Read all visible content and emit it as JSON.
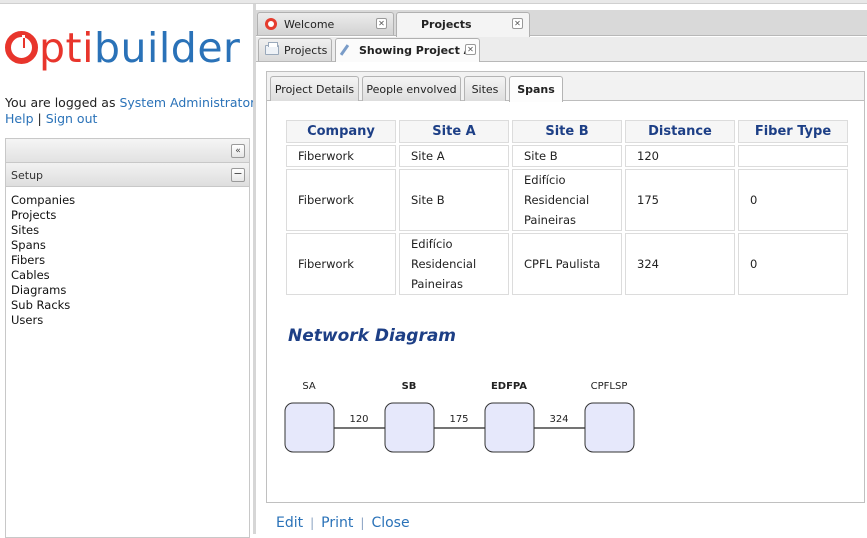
{
  "app": {
    "logo_prefix": "o",
    "logo_red": "pti",
    "logo_blue": "builder"
  },
  "session": {
    "logged_as_text": "You are logged as ",
    "user_name": "System Administrator",
    "help_label": "Help",
    "separator": "|",
    "signout_label": "Sign out"
  },
  "sidebar": {
    "collapse_icon": "double-chevron-left-icon",
    "section_title": "Setup",
    "minimize_icon": "minus-icon",
    "items": [
      {
        "label": "Companies"
      },
      {
        "label": "Projects"
      },
      {
        "label": "Sites"
      },
      {
        "label": "Spans"
      },
      {
        "label": "Fibers"
      },
      {
        "label": "Cables"
      },
      {
        "label": "Diagrams"
      },
      {
        "label": "Sub Racks"
      },
      {
        "label": "Users"
      }
    ]
  },
  "main_tabs": [
    {
      "label": "Welcome",
      "active": false,
      "icon": "optibuilder-icon"
    },
    {
      "label": "Projects",
      "active": true
    }
  ],
  "sub_tabs": [
    {
      "label": "Projects",
      "active": false,
      "icon": "document-icon"
    },
    {
      "label": "Showing Project A",
      "active": true,
      "icon": "pencil-icon"
    }
  ],
  "detail_tabs": [
    {
      "label": "Project Details",
      "active": false
    },
    {
      "label": "People envolved",
      "active": false
    },
    {
      "label": "Sites",
      "active": false
    },
    {
      "label": "Spans",
      "active": true
    }
  ],
  "spans_table": {
    "headers": [
      "Company",
      "Site A",
      "Site B",
      "Distance",
      "Fiber Type"
    ],
    "rows": [
      {
        "company": "Fiberwork",
        "site_a": [
          "Site A"
        ],
        "site_b": [
          "Site B"
        ],
        "distance": "120",
        "fiber_type": ""
      },
      {
        "company": "Fiberwork",
        "site_a": [
          "Site B"
        ],
        "site_b": [
          "Edifício",
          "Residencial",
          "Paineiras"
        ],
        "distance": "175",
        "fiber_type": "0"
      },
      {
        "company": "Fiberwork",
        "site_a": [
          "Edifício",
          "Residencial",
          "Paineiras"
        ],
        "site_b": [
          "CPFL Paulista"
        ],
        "distance": "324",
        "fiber_type": "0"
      }
    ]
  },
  "diagram": {
    "title": "Network Diagram",
    "nodes": [
      {
        "label": "SA",
        "bold": false
      },
      {
        "label": "SB",
        "bold": true
      },
      {
        "label": "EDFPA",
        "bold": true
      },
      {
        "label": "CPFLSP",
        "bold": false
      }
    ],
    "links": [
      {
        "label": "120"
      },
      {
        "label": "175"
      },
      {
        "label": "324"
      }
    ],
    "colors": {
      "node_fill": "#e6e8fb",
      "node_stroke": "#333333",
      "link": "#222222"
    }
  },
  "actions": {
    "edit_label": "Edit",
    "print_label": "Print",
    "close_label": "Close",
    "separator": "|"
  },
  "colors": {
    "brand_red": "#e8352c",
    "brand_blue": "#2a72b8",
    "heading_blue": "#1d3f86"
  }
}
